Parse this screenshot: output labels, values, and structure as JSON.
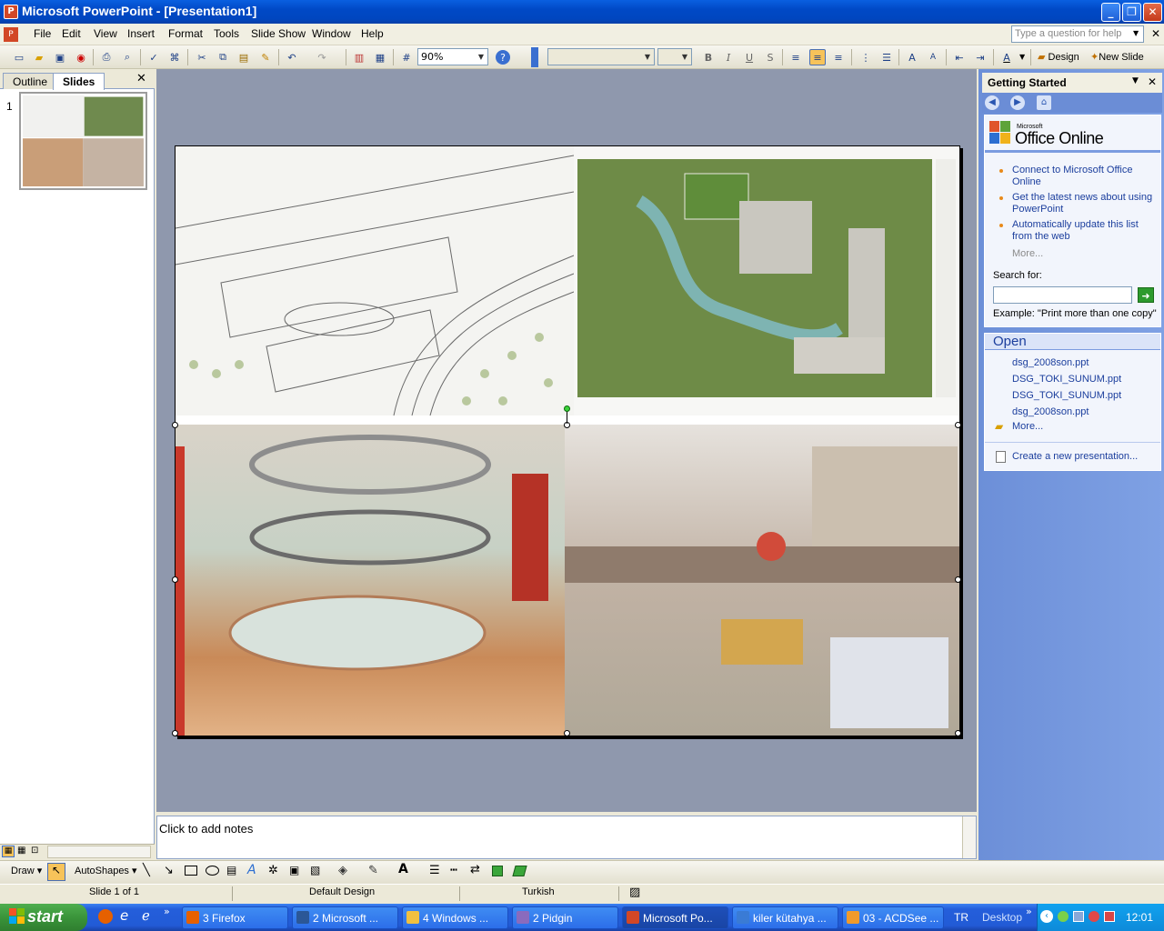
{
  "window": {
    "title": "Microsoft PowerPoint - [Presentation1]"
  },
  "menu": [
    "File",
    "Edit",
    "View",
    "Insert",
    "Format",
    "Tools",
    "Slide Show",
    "Window",
    "Help"
  ],
  "help_box": {
    "placeholder": "Type a question for help"
  },
  "toolbar": {
    "zoom": "90%",
    "design_label": "Design",
    "new_slide_label": "New Slide"
  },
  "left_pane": {
    "tabs": [
      "Outline",
      "Slides"
    ],
    "active_tab": "Slides",
    "slide_number": "1"
  },
  "notes": {
    "placeholder": "Click to add notes"
  },
  "task_pane": {
    "title": "Getting Started",
    "office_online_brand": "Office Online",
    "office_online_small": "Microsoft",
    "links": [
      {
        "line1": "Connect to Microsoft Office",
        "line2": "Online"
      },
      {
        "line1": "Get the latest news about using",
        "line2": "PowerPoint"
      },
      {
        "line1": "Automatically update this list",
        "line2": "from the web"
      }
    ],
    "more1": "More...",
    "search_label": "Search for:",
    "example": "Example:  \"Print more than one copy\"",
    "open_header": "Open",
    "files": [
      "dsg_2008son.ppt",
      "DSG_TOKI_SUNUM.ppt",
      "DSG_TOKI_SUNUM.ppt",
      "dsg_2008son.ppt"
    ],
    "more2": "More...",
    "create_new": "Create a new presentation..."
  },
  "drawing_toolbar": {
    "draw": "Draw",
    "autoshapes": "AutoShapes"
  },
  "status": {
    "slide": "Slide 1 of 1",
    "design": "Default Design",
    "language": "Turkish"
  },
  "taskbar": {
    "start": "start",
    "tasks": [
      {
        "label": "3 Firefox",
        "color": "#e66000"
      },
      {
        "label": "2 Microsoft ...",
        "color": "#2b5797"
      },
      {
        "label": "4 Windows ...",
        "color": "#f0c040"
      },
      {
        "label": "2 Pidgin",
        "color": "#8a6bbd"
      },
      {
        "label": "Microsoft Po...",
        "color": "#d24726"
      },
      {
        "label": "kiler kütahya ...",
        "color": "#3a7bd5"
      },
      {
        "label": "03 - ACDSee ...",
        "color": "#f19a2b"
      }
    ],
    "lang": "TR",
    "desktop": "Desktop",
    "clock": "12:01"
  }
}
